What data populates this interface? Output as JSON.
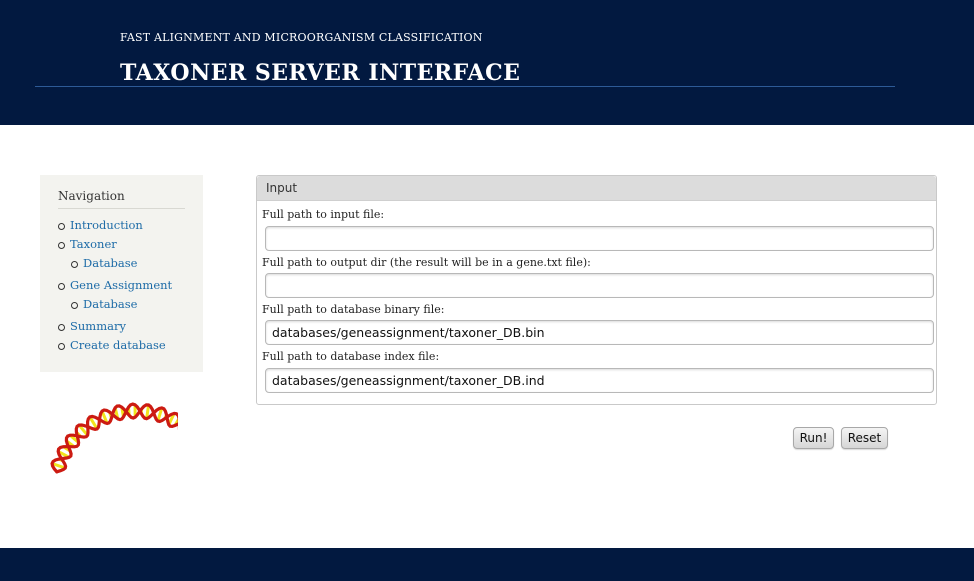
{
  "header": {
    "subtitle": "FAST ALIGNMENT AND MICROORGANISM CLASSIFICATION",
    "title": "TAXONER SERVER INTERFACE"
  },
  "nav": {
    "title": "Navigation",
    "items": [
      {
        "label": "Introduction"
      },
      {
        "label": "Taxoner",
        "children": [
          {
            "label": "Database"
          }
        ]
      },
      {
        "label": "Gene Assignment",
        "children": [
          {
            "label": "Database"
          }
        ]
      },
      {
        "label": "Summary"
      },
      {
        "label": "Create database"
      }
    ]
  },
  "panel": {
    "title": "Input",
    "fields": [
      {
        "label": "Full path to input file:",
        "value": ""
      },
      {
        "label": "Full path to output dir (the result will be in a gene.txt file):",
        "value": ""
      },
      {
        "label": "Full path to database binary file:",
        "value": "databases/geneassignment/taxoner_DB.bin"
      },
      {
        "label": "Full path to database index file:",
        "value": "databases/geneassignment/taxoner_DB.ind"
      }
    ]
  },
  "buttons": {
    "run_label": "Run!",
    "reset_label": "Reset"
  },
  "colors": {
    "header_bg": "#021940",
    "link": "#1d6ba7",
    "dna_red": "#cc1b12",
    "dna_yellow": "#f2e41c"
  },
  "images": {
    "logo": "dna-helix-icon"
  }
}
